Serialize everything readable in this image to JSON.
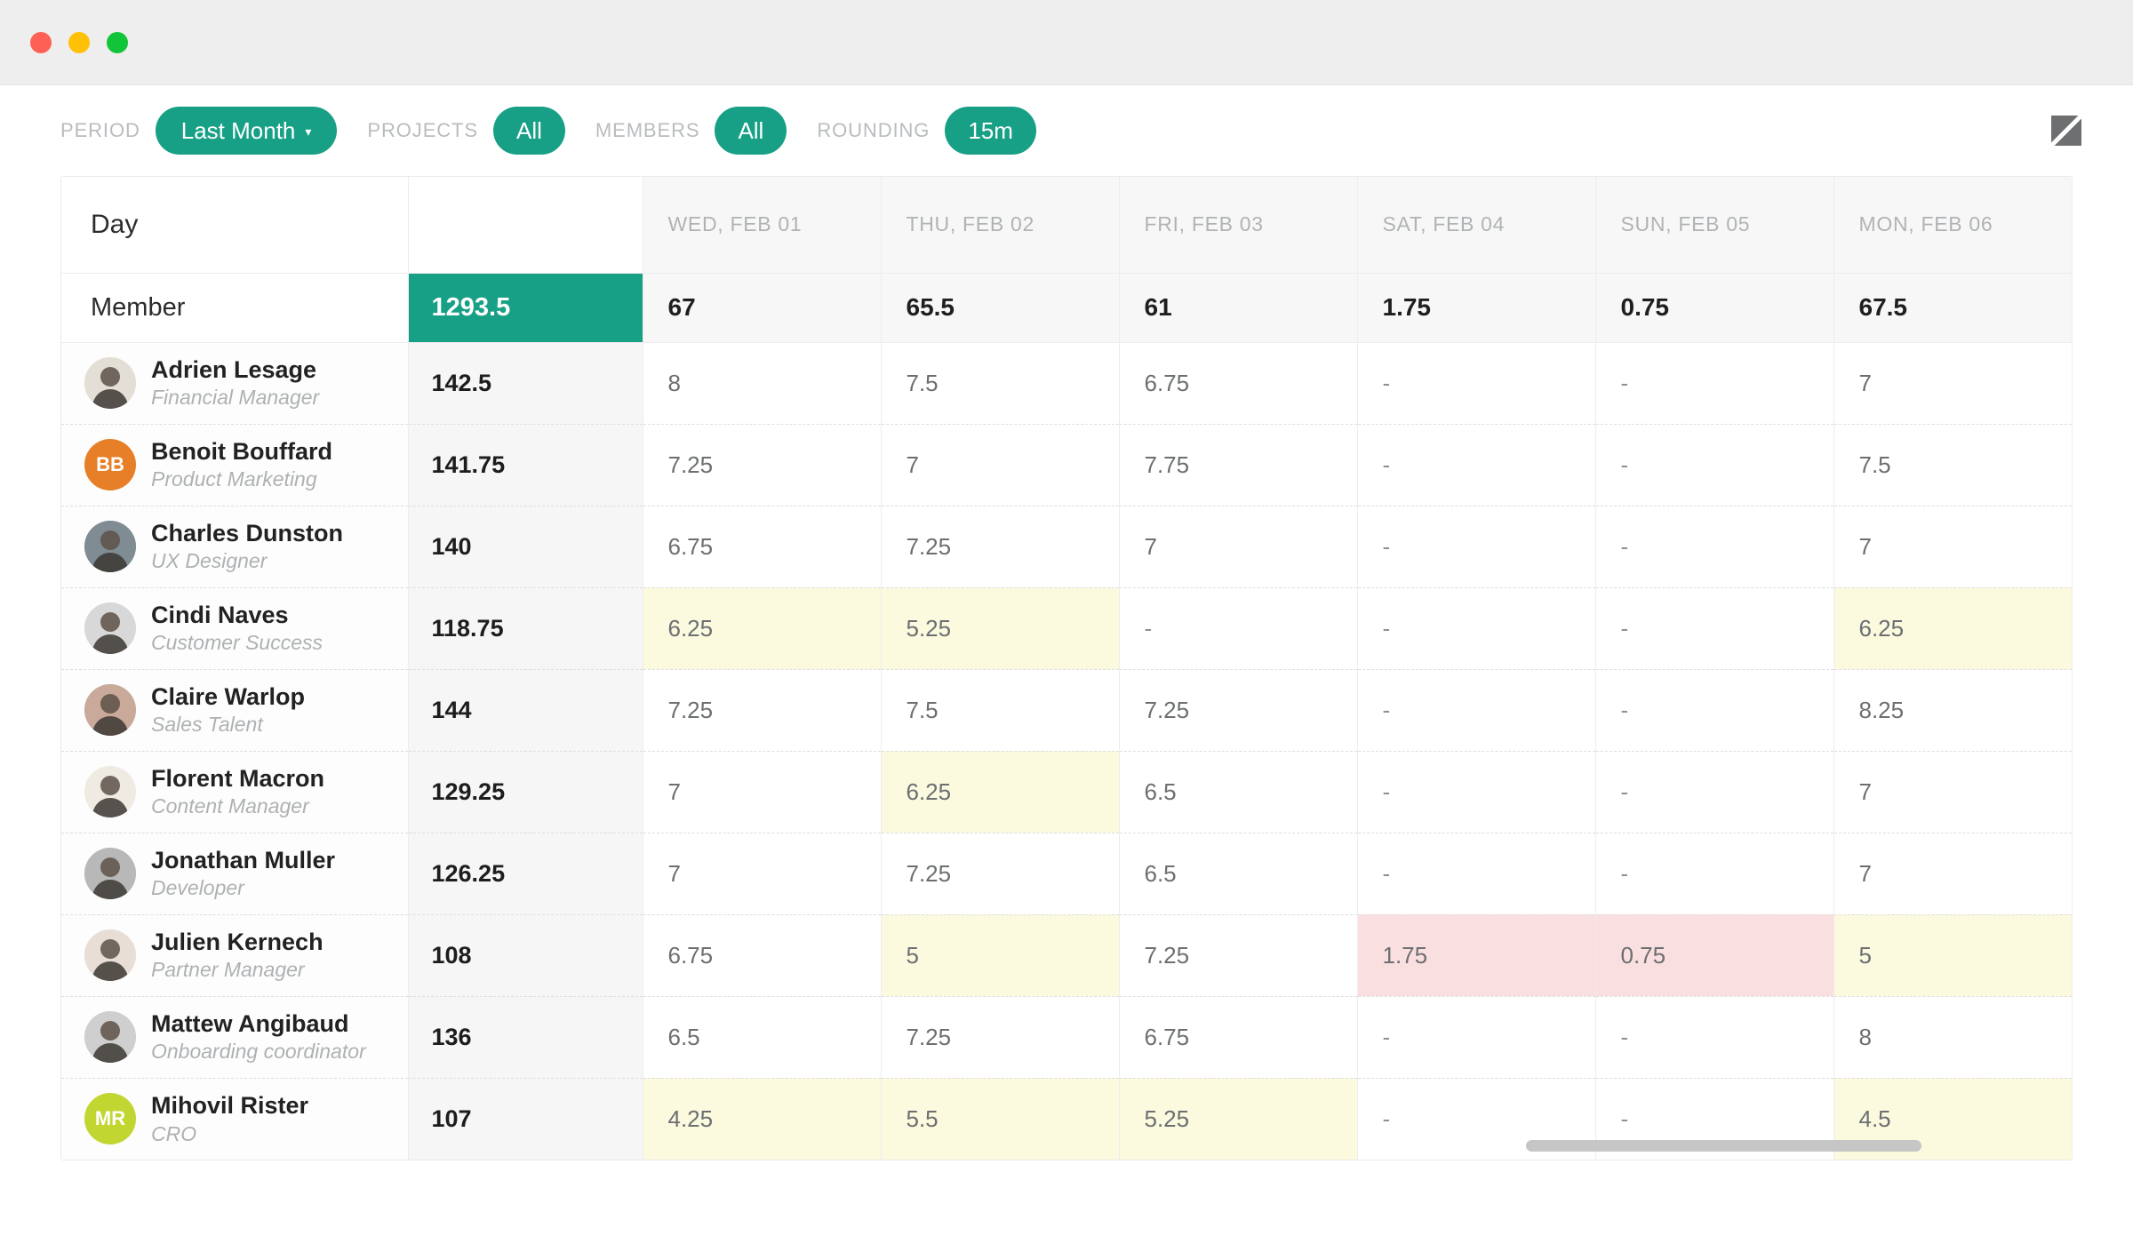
{
  "window": {
    "traffic_lights": [
      "close",
      "minimize",
      "maximize"
    ]
  },
  "toolbar": {
    "filters": [
      {
        "label": "PERIOD",
        "value": "Last Month",
        "has_caret": true,
        "name": "period"
      },
      {
        "label": "PROJECTS",
        "value": "All",
        "has_caret": false,
        "name": "projects"
      },
      {
        "label": "MEMBERS",
        "value": "All",
        "has_caret": false,
        "name": "members"
      },
      {
        "label": "ROUNDING",
        "value": "15m",
        "has_caret": false,
        "name": "rounding"
      }
    ],
    "caret_glyph": "▾",
    "expand_icon": "expand-icon",
    "accent_color": "#17a085"
  },
  "table": {
    "day_header_label": "Day",
    "member_header_label": "Member",
    "grand_total": "1293.5",
    "empty_value": "-",
    "days": [
      {
        "label": "WED, FEB 01",
        "total": "67"
      },
      {
        "label": "THU, FEB 02",
        "total": "65.5"
      },
      {
        "label": "FRI, FEB 03",
        "total": "61"
      },
      {
        "label": "SAT, FEB 04",
        "total": "1.75"
      },
      {
        "label": "SUN, FEB 05",
        "total": "0.75"
      },
      {
        "label": "MON, FEB 06",
        "total": "67.5"
      }
    ],
    "highlight_colors": {
      "yellow": "#fbfadf",
      "pink": "#fadfe0"
    },
    "rows": [
      {
        "name": "Adrien Lesage",
        "role": "Financial Manager",
        "total": "142.5",
        "avatar": {
          "type": "photo",
          "initials": "AL",
          "color": "#e3ded6"
        },
        "cells": [
          {
            "v": "8",
            "hl": "none"
          },
          {
            "v": "7.5",
            "hl": "none"
          },
          {
            "v": "6.75",
            "hl": "none"
          },
          {
            "v": "-",
            "hl": "none"
          },
          {
            "v": "-",
            "hl": "none"
          },
          {
            "v": "7",
            "hl": "none"
          }
        ]
      },
      {
        "name": "Benoit Bouffard",
        "role": "Product Marketing",
        "total": "141.75",
        "avatar": {
          "type": "initials",
          "initials": "BB",
          "color": "#e77f28"
        },
        "cells": [
          {
            "v": "7.25",
            "hl": "none"
          },
          {
            "v": "7",
            "hl": "none"
          },
          {
            "v": "7.75",
            "hl": "none"
          },
          {
            "v": "-",
            "hl": "none"
          },
          {
            "v": "-",
            "hl": "none"
          },
          {
            "v": "7.5",
            "hl": "none"
          }
        ]
      },
      {
        "name": "Charles Dunston",
        "role": "UX Designer",
        "total": "140",
        "avatar": {
          "type": "photo",
          "initials": "CD",
          "color": "#7f8c93"
        },
        "cells": [
          {
            "v": "6.75",
            "hl": "none"
          },
          {
            "v": "7.25",
            "hl": "none"
          },
          {
            "v": "7",
            "hl": "none"
          },
          {
            "v": "-",
            "hl": "none"
          },
          {
            "v": "-",
            "hl": "none"
          },
          {
            "v": "7",
            "hl": "none"
          }
        ]
      },
      {
        "name": "Cindi Naves",
        "role": "Customer Success",
        "total": "118.75",
        "avatar": {
          "type": "photo",
          "initials": "CN",
          "color": "#d8d8d8"
        },
        "cells": [
          {
            "v": "6.25",
            "hl": "yellow"
          },
          {
            "v": "5.25",
            "hl": "yellow"
          },
          {
            "v": "-",
            "hl": "none"
          },
          {
            "v": "-",
            "hl": "none"
          },
          {
            "v": "-",
            "hl": "none"
          },
          {
            "v": "6.25",
            "hl": "yellow"
          }
        ]
      },
      {
        "name": "Claire Warlop",
        "role": "Sales Talent",
        "total": "144",
        "avatar": {
          "type": "photo",
          "initials": "CW",
          "color": "#c9a99a"
        },
        "cells": [
          {
            "v": "7.25",
            "hl": "none"
          },
          {
            "v": "7.5",
            "hl": "none"
          },
          {
            "v": "7.25",
            "hl": "none"
          },
          {
            "v": "-",
            "hl": "none"
          },
          {
            "v": "-",
            "hl": "none"
          },
          {
            "v": "8.25",
            "hl": "none"
          }
        ]
      },
      {
        "name": "Florent Macron",
        "role": "Content Manager",
        "total": "129.25",
        "avatar": {
          "type": "photo",
          "initials": "FM",
          "color": "#efeae2"
        },
        "cells": [
          {
            "v": "7",
            "hl": "none"
          },
          {
            "v": "6.25",
            "hl": "yellow"
          },
          {
            "v": "6.5",
            "hl": "none"
          },
          {
            "v": "-",
            "hl": "none"
          },
          {
            "v": "-",
            "hl": "none"
          },
          {
            "v": "7",
            "hl": "none"
          }
        ]
      },
      {
        "name": "Jonathan Muller",
        "role": "Developer",
        "total": "126.25",
        "avatar": {
          "type": "photo",
          "initials": "JM",
          "color": "#b8b8b8"
        },
        "cells": [
          {
            "v": "7",
            "hl": "none"
          },
          {
            "v": "7.25",
            "hl": "none"
          },
          {
            "v": "6.5",
            "hl": "none"
          },
          {
            "v": "-",
            "hl": "none"
          },
          {
            "v": "-",
            "hl": "none"
          },
          {
            "v": "7",
            "hl": "none"
          }
        ]
      },
      {
        "name": "Julien Kernech",
        "role": "Partner Manager",
        "total": "108",
        "avatar": {
          "type": "photo",
          "initials": "JK",
          "color": "#e8ded6"
        },
        "cells": [
          {
            "v": "6.75",
            "hl": "none"
          },
          {
            "v": "5",
            "hl": "yellow"
          },
          {
            "v": "7.25",
            "hl": "none"
          },
          {
            "v": "1.75",
            "hl": "pink"
          },
          {
            "v": "0.75",
            "hl": "pink"
          },
          {
            "v": "5",
            "hl": "yellow"
          }
        ]
      },
      {
        "name": "Mattew Angibaud",
        "role": "Onboarding coordinator",
        "total": "136",
        "avatar": {
          "type": "photo",
          "initials": "MA",
          "color": "#cfcfcf"
        },
        "cells": [
          {
            "v": "6.5",
            "hl": "none"
          },
          {
            "v": "7.25",
            "hl": "none"
          },
          {
            "v": "6.75",
            "hl": "none"
          },
          {
            "v": "-",
            "hl": "none"
          },
          {
            "v": "-",
            "hl": "none"
          },
          {
            "v": "8",
            "hl": "none"
          }
        ]
      },
      {
        "name": "Mihovil Rister",
        "role": "CRO",
        "total": "107",
        "avatar": {
          "type": "initials",
          "initials": "MR",
          "color": "#c2d632"
        },
        "cells": [
          {
            "v": "4.25",
            "hl": "yellow"
          },
          {
            "v": "5.5",
            "hl": "yellow"
          },
          {
            "v": "5.25",
            "hl": "yellow"
          },
          {
            "v": "-",
            "hl": "none"
          },
          {
            "v": "-",
            "hl": "none"
          },
          {
            "v": "4.5",
            "hl": "yellow"
          }
        ]
      }
    ]
  }
}
